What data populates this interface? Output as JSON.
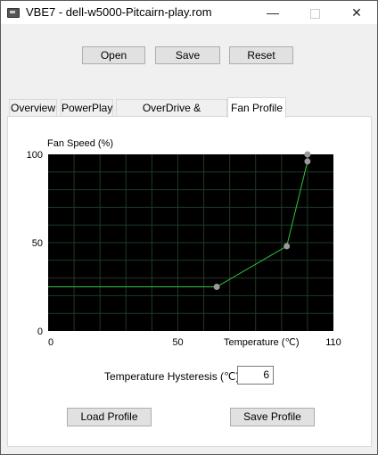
{
  "window": {
    "title": "VBE7 - dell-w5000-Pitcairn-play.rom",
    "minimize": "—",
    "close": "✕"
  },
  "toolbar": {
    "open_label": "Open",
    "save_label": "Save",
    "reset_label": "Reset"
  },
  "tabs": [
    {
      "label": "Overview",
      "active": false
    },
    {
      "label": "PowerPlay",
      "active": false
    },
    {
      "label": "OverDrive & PowerTune",
      "active": false
    },
    {
      "label": "Fan Profile",
      "active": true
    }
  ],
  "fan_profile": {
    "hysteresis_label": "Temperature Hysteresis (℃)",
    "hysteresis_value": "6",
    "load_label": "Load Profile",
    "save_label": "Save Profile"
  },
  "colors": {
    "plot_background": "#000000",
    "grid": "#1f3a24",
    "curve": "#34c13a",
    "point": "#9a9a9a"
  },
  "chart_data": {
    "type": "line",
    "ylabel": "Fan Speed (%)",
    "xlabel": "Temperature (℃)",
    "xlim": [
      0,
      110
    ],
    "ylim": [
      0,
      100
    ],
    "x_tick_labels": [
      "0",
      "50",
      "110"
    ],
    "y_tick_labels": [
      "100",
      "50",
      "0"
    ],
    "x_ticks": [
      0,
      50,
      110
    ],
    "y_ticks": [
      100,
      50,
      0
    ],
    "grid": true,
    "series": [
      {
        "x": [
          0,
          65,
          92,
          100,
          100
        ],
        "y": [
          25,
          25,
          48,
          96,
          100
        ],
        "markers": [
          false,
          true,
          true,
          true,
          true
        ]
      }
    ]
  }
}
